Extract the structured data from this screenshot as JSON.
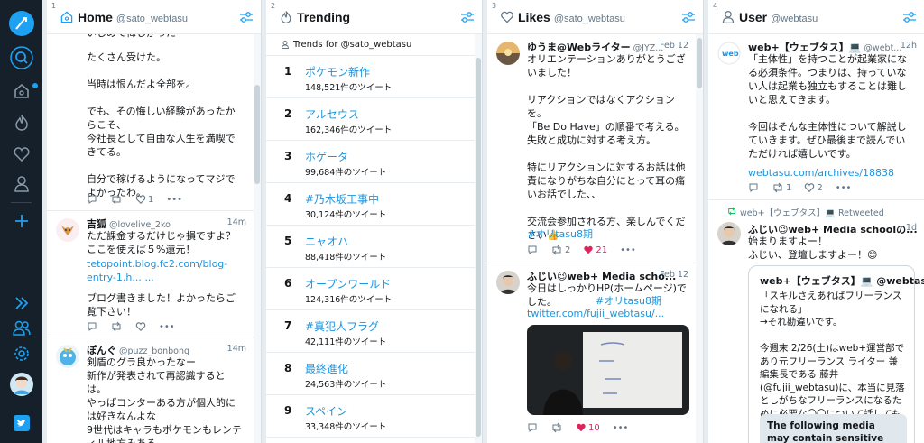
{
  "colors": {
    "accent": "#1da1f2",
    "link": "#1b95e0",
    "like": "#e0245e",
    "sidebar": "#15202b"
  },
  "sidebar": {
    "icons": [
      "compose-icon",
      "search-icon",
      "home-icon",
      "trending-icon",
      "likes-icon",
      "user-icon",
      "add-column-icon",
      "expand-icon",
      "accounts-icon",
      "settings-icon",
      "avatar",
      "twitter-logo-icon"
    ]
  },
  "columns": [
    {
      "num": "1",
      "title": "Home",
      "handle": "@sato_webtasu",
      "icon": "home-icon",
      "tweets": [
        {
          "body": "たくさん受けた。\n\n当時は恨んだよ全部を。\n\nでも、その悔しい経験があったからこそ、\n今社長として自由な人生を満喫できてる。\n\n自分で稼げるようになってマジでよかったわ。",
          "top_fragment": "いじめて悔しかった",
          "reply": "",
          "retweet": "",
          "like": "1"
        },
        {
          "name": "吉狐",
          "handle": "@lovelive_2ko",
          "time": "14m",
          "body": "ただ課金するだけじゃ損ですよ？\nここを使えば５%還元！",
          "link": "tetopoint.blog.fc2.com/blog-entry-1.h... ...",
          "body2": "ブログ書きました！よかったらご覧下さい！"
        },
        {
          "name": "ぽんぐ",
          "handle": "@puzz_bonbong",
          "time": "14m",
          "body": "剣盾のグラ良かったなー\n新作が発表されて再認識するとは。\nやっぱコンターある方が個人的には好きなんよな\n9世代はキャラもポケモンもレンティル地方みある。"
        }
      ]
    },
    {
      "num": "2",
      "title": "Trending",
      "icon": "trending-icon",
      "trends_for": "Trends for @sato_webtasu",
      "trends": [
        {
          "rank": "1",
          "name": "ポケモン新作",
          "count": "148,521件のツイート"
        },
        {
          "rank": "2",
          "name": "アルセウス",
          "count": "162,346件のツイート"
        },
        {
          "rank": "3",
          "name": "ホゲータ",
          "count": "99,684件のツイート"
        },
        {
          "rank": "4",
          "name": "#乃木坂工事中",
          "count": "30,124件のツイート"
        },
        {
          "rank": "5",
          "name": "ニャオハ",
          "count": "88,418件のツイート"
        },
        {
          "rank": "6",
          "name": "オープンワールド",
          "count": "124,316件のツイート"
        },
        {
          "rank": "7",
          "name": "#真犯人フラグ",
          "count": "42,111件のツイート"
        },
        {
          "rank": "8",
          "name": "最終進化",
          "count": "24,563件のツイート"
        },
        {
          "rank": "9",
          "name": "スペイン",
          "count": "33,348件のツイート"
        }
      ]
    },
    {
      "num": "3",
      "title": "Likes",
      "handle": "@sato_webtasu",
      "icon": "likes-icon",
      "tweets": [
        {
          "name": "ゆうま@Webライター",
          "handle": "@JYZ...",
          "time": "Feb 12",
          "body": "オリエンテーションありがとうございました！\n\nリアクションではなくアクションを。\n「Be Do Have」の順番で考える。\n失敗と成功に対する考え方。\n\n特にリアクションに対するお話は他責になりがちな自分にとって耳の痛いお話でした、、\n\n交流会参加される方、楽しんでください👍",
          "hashtag": "#オリtasu8期",
          "retweet": "2",
          "like": "21"
        },
        {
          "name": "ふじい😉web+ Media scho...",
          "time": "Feb 12",
          "body": "今日はしっかりHP(ホームページ)でした。",
          "hashtag": "#オリtasu8期",
          "link": "twitter.com/fujii_webtasu/...",
          "like": "10"
        }
      ]
    },
    {
      "num": "4",
      "title": "User",
      "handle": "@webtasu",
      "icon": "user-icon",
      "tweets": [
        {
          "name": "web+【ウェブタス】💻",
          "handle": "@webt...",
          "time": "12h",
          "body": "「主体性」を持つことが起業家になる必須条件。つまりは、持っていない人は起業も独立もすることは難しいと思えてきます。\n\n今回はそんな主体性について解説していきます。ぜひ最後まで読んでいただければ嬉しいです。",
          "link": "webtasu.com/archives/18838",
          "retweet": "1",
          "like": "2"
        },
        {
          "retweeted_by": "web+【ウェブタス】💻 Retweeted",
          "name": "ふじい😉web+ Media schoolの...",
          "time": "1d",
          "body": "始まりますよー！\nふじい、登壇しますよー！😊",
          "quote": {
            "name": "web+【ウェブタス】💻 @webtasu",
            "body": "「スキルさえあればフリーランスになれる」\n→それ勘違いです。\n\n今週末 2/26(土)はweb+運営部であり元フリーランス ライター 兼 編集長である 藤井(@fujii_webtasu)に、本当に見落としがちなフリーランスになるために必要な〇〇について話してもらいます！",
            "sensitive": "The following media may contain sensitive material."
          }
        }
      ]
    }
  ]
}
